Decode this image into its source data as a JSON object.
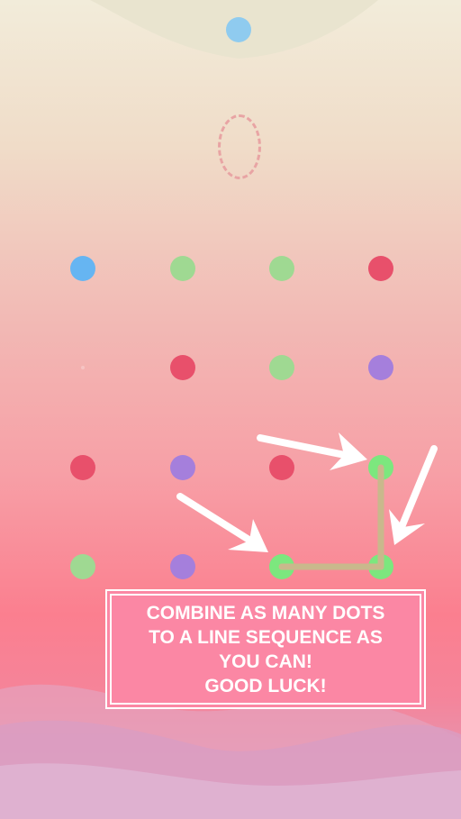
{
  "colors": {
    "blue": "#66b5f2",
    "green": "#9fd992",
    "red": "#e8506b",
    "purple": "#a57fdc",
    "bright_green": "#7ce77e",
    "line": "#c9b88c",
    "target": "#8fcbef"
  },
  "target_dot": {
    "color": "blue"
  },
  "grid": {
    "rows": [
      [
        "blue",
        "green",
        "green",
        "red"
      ],
      [
        "empty",
        "red",
        "green",
        "purple"
      ],
      [
        "red",
        "purple",
        "red",
        "bright_green"
      ],
      [
        "green",
        "purple",
        "bright_green",
        "bright_green"
      ]
    ]
  },
  "tutorial": {
    "lines": [
      "COMBINE AS MANY DOTS",
      "TO A LINE SEQUENCE AS",
      "YOU CAN!",
      "GOOD LUCK!"
    ]
  }
}
